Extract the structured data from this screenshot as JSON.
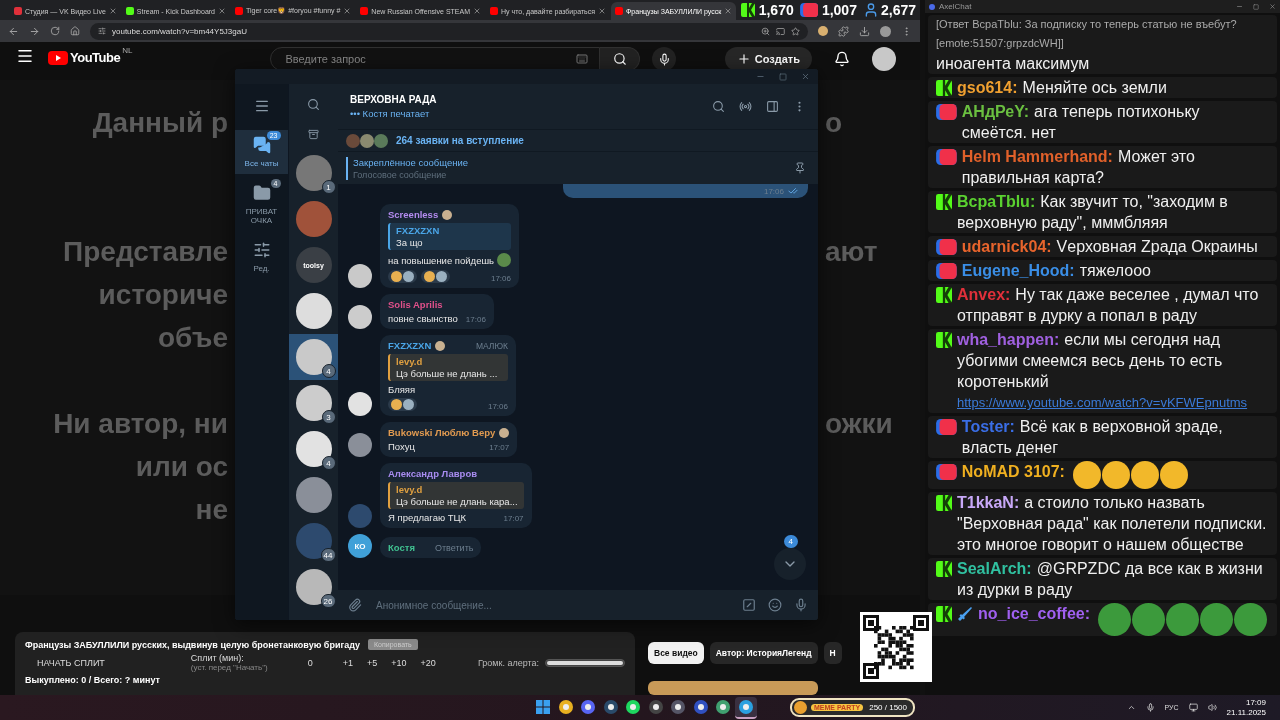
{
  "browser": {
    "tabs": [
      {
        "title": "Студия — VK Видео Live",
        "kind": "vk",
        "selected": false
      },
      {
        "title": "Stream - Kick Dashboard",
        "kind": "kick",
        "selected": false
      },
      {
        "title": "Tiger core🦁 #foryou #funny #",
        "kind": "youtube",
        "selected": false
      },
      {
        "title": "New Russian Offensive STEAM",
        "kind": "youtube",
        "selected": false
      },
      {
        "title": "Ну что, давайте разбираться",
        "kind": "youtube",
        "selected": false
      },
      {
        "title": "Французы ЗАБУЛЛИЛИ русск",
        "kind": "youtube",
        "selected": true
      }
    ],
    "address": "youtube.com/watch?v=bm44Y5J3gaU"
  },
  "stream_stats": [
    {
      "kind": "kick",
      "value": "1,670"
    },
    {
      "kind": "vk",
      "value": "1,007"
    },
    {
      "kind": "viewers",
      "value": "2,677"
    }
  ],
  "youtube": {
    "logo": "YouTube",
    "region": "NL",
    "search_placeholder": "Введите запрос",
    "create_label": "Создать",
    "video_paragraphs": [
      [
        {
          "left": "Данный р",
          "right": "о"
        }
      ],
      [
        {
          "left": "Представле",
          "right": "ают"
        },
        {
          "left": "историче"
        },
        {
          "left": "объе"
        }
      ],
      [
        {
          "left": "Ни автор, ни",
          "right": "ожки"
        },
        {
          "left": "или ос"
        },
        {
          "left": "не"
        }
      ]
    ],
    "panel": {
      "title": "Французы ЗАБУЛЛИЛИ русских, выдвинув целую бронетанковую бригаду",
      "copy_button": "Копировать",
      "start_button": "НАЧАТЬ СПЛИТ",
      "split_label": "Сплит (мин):",
      "split_hint": "(уст. перед \"Начать\")",
      "split_value": "0",
      "steps": [
        "+1",
        "+5",
        "+10",
        "+20"
      ],
      "volume_label": "Громк. алерта:",
      "volume": {
        "level": 1
      },
      "summary": "Выкуплено: 0 / Всего: ? минут"
    },
    "filter_chips": [
      {
        "label": "Все видео",
        "selected": true
      },
      {
        "label": "Автор: ИсторияЛегенд",
        "selected": false
      },
      {
        "label": "Н",
        "selected": false
      }
    ]
  },
  "telegram": {
    "folders": [
      {
        "label": "Все чаты",
        "kind": "chats",
        "badge": "23",
        "selected": true
      },
      {
        "label": "ПРИВАТ ОЧКА",
        "kind": "folder",
        "badge": "4",
        "selected": false
      },
      {
        "label": "Ред.",
        "kind": "edit",
        "selected": false
      }
    ],
    "chats": [
      {
        "badge": "1",
        "selected": false
      },
      {
        "selected": false
      },
      {
        "logo": "toolsy",
        "selected": false
      },
      {
        "selected": false
      },
      {
        "badge": "4",
        "selected": true
      },
      {
        "badge": "3",
        "selected": false
      },
      {
        "badge": "4",
        "selected": false
      },
      {
        "selected": false
      },
      {
        "badge": "44",
        "selected": false
      },
      {
        "badge": "26",
        "selected": false
      }
    ],
    "title": "ВЕРХОВНА РАДА",
    "typing": "••• Костя печатает",
    "join_requests": "264 заявки на вступление",
    "pinned": {
      "title": "Закреплённое сообщение",
      "text": "Голосовое сообщение"
    },
    "messages": [
      {
        "kind": "own",
        "time": "17:06"
      },
      {
        "kind": "incoming",
        "author": "Screenless",
        "color": "#b48cf0",
        "emoji_status": true,
        "reply": {
          "author": "FXZXZXN",
          "color": "#4aa6e8",
          "text": "За що"
        },
        "text": "на повышение пойдешь",
        "trailing_emoji": true,
        "reactions": [
          {
            "kind": "pair"
          },
          {
            "kind": "pair"
          }
        ],
        "time": "17:06"
      },
      {
        "kind": "incoming",
        "author": "Solis Aprilis",
        "color": "#e0508a",
        "emoji_status": false,
        "text": "повне свынство",
        "trailing_emoji": false,
        "time": "17:06"
      },
      {
        "kind": "incoming",
        "author": "FXZXZXN",
        "color": "#4aa6e8",
        "emoji_status": true,
        "tag": "МАЛЮК",
        "reply": {
          "author": "levy.d",
          "color": "#e0a040",
          "text": "Цэ больше не длань ..."
        },
        "text": "Бляяя",
        "trailing_emoji": false,
        "reactions": [
          {
            "kind": "pair"
          }
        ],
        "time": "17:06"
      },
      {
        "kind": "incoming",
        "author": "Bukowski Люблю Веру",
        "color": "#e09a50",
        "emoji_status": true,
        "text": "Похуц",
        "trailing_emoji": false,
        "time": "17:07"
      },
      {
        "kind": "incoming",
        "author": "Александр Лавров",
        "color": "#a88cf0",
        "emoji_status": false,
        "reply": {
          "author": "levy.d",
          "color": "#e0a040",
          "text": "Цэ больше не длань кара..."
        },
        "text": "Я предлагаю ТЦК",
        "trailing_emoji": false,
        "time": "17:07"
      },
      {
        "kind": "partial",
        "author": "Костя",
        "color": "#40c090",
        "avatar_text": "КО",
        "action": "Ответить"
      }
    ],
    "unread": "4",
    "input_placeholder": "Анонимное сообщение..."
  },
  "chat": {
    "title": "AxelChat",
    "messages": [
      {
        "kind": "none",
        "reply": "[Ответ BcpaTblu: За подписку то теперь статью не въебут? [emote:51507:grpzdcWH]]",
        "text": "иноагента максимум"
      },
      {
        "kind": "kick",
        "name": "gso614:",
        "color": "#f0a030",
        "text": "Меняйте ось земли"
      },
      {
        "kind": "vk",
        "name": "АНдРеY:",
        "color": "#6abf40",
        "text": "ага теперь потихоньку смеётся. нет"
      },
      {
        "kind": "vk",
        "name": "Helm Hammerhand:",
        "color": "#e0602a",
        "text": "Может это правильная карта?"
      },
      {
        "kind": "kick",
        "name": "BcpaTblu:",
        "color": "#5ad130",
        "text": "Как звучит то, \"заходим в верховную раду\", мммбляяя"
      },
      {
        "kind": "vk",
        "name": "udarnick04:",
        "color": "#e8642c",
        "text": "Vерховная Zрада Окраины"
      },
      {
        "kind": "vk",
        "name": "Eugene_Hood:",
        "color": "#3a8ee6",
        "text": "тяжелооо"
      },
      {
        "kind": "kick",
        "name": "Anvex:",
        "color": "#e0303a",
        "text": "Ну так даже веселее , думал что отправят в дурку а попал в раду"
      },
      {
        "kind": "kick",
        "name": "wha_happen:",
        "color": "#a060e0",
        "text": "если мы сегодня над убогими смеемся весь день то есть коротенький",
        "link": "https://www.youtube.com/watch?v=vKFWEpnutms"
      },
      {
        "kind": "vk",
        "name": "Toster:",
        "color": "#3a6ee6",
        "text": "Всё как в верховной зраде, власть денег"
      },
      {
        "kind": "vk",
        "name": "NoMAD 3107:",
        "color": "#f0b020",
        "emotes": [
          {
            "kind": "laughing"
          },
          {
            "kind": "laughing"
          },
          {
            "kind": "laughing"
          },
          {
            "kind": "laughing"
          }
        ]
      },
      {
        "kind": "kick",
        "name": "T1kkaN:",
        "color": "#c8a8f8",
        "text": "а стоило только назвать \"Верховная рада\" как полетели подписки. это многое говорит о нашем обществе"
      },
      {
        "kind": "kick",
        "name": "SealArch:",
        "color": "#30c0a0",
        "text": "@GRPZDC да все как в жизни из дурки в раду"
      },
      {
        "kind": "kick",
        "name": "no_ice_coffee:",
        "color": "#a060f0",
        "sword_badge": true,
        "emotes": [
          {
            "kind": "frog"
          },
          {
            "kind": "frog"
          },
          {
            "kind": "frog"
          },
          {
            "kind": "frog"
          },
          {
            "kind": "frog"
          }
        ]
      }
    ]
  },
  "taskbar": {
    "apps": [
      {
        "kind": "windows",
        "active": false
      },
      {
        "kind": "chrome",
        "active": false
      },
      {
        "kind": "discord",
        "active": false
      },
      {
        "kind": "steam",
        "active": false
      },
      {
        "kind": "spotify",
        "active": false
      },
      {
        "kind": "obs",
        "active": false
      },
      {
        "kind": "app",
        "active": false
      },
      {
        "kind": "player",
        "active": false
      },
      {
        "kind": "tiles",
        "active": false
      },
      {
        "kind": "telegram",
        "active": true
      }
    ],
    "widget": {
      "title": "MEME PARTY",
      "count": "250 / 1500"
    },
    "language": "РУС",
    "time": "17:09",
    "date": "21.11.2025"
  }
}
